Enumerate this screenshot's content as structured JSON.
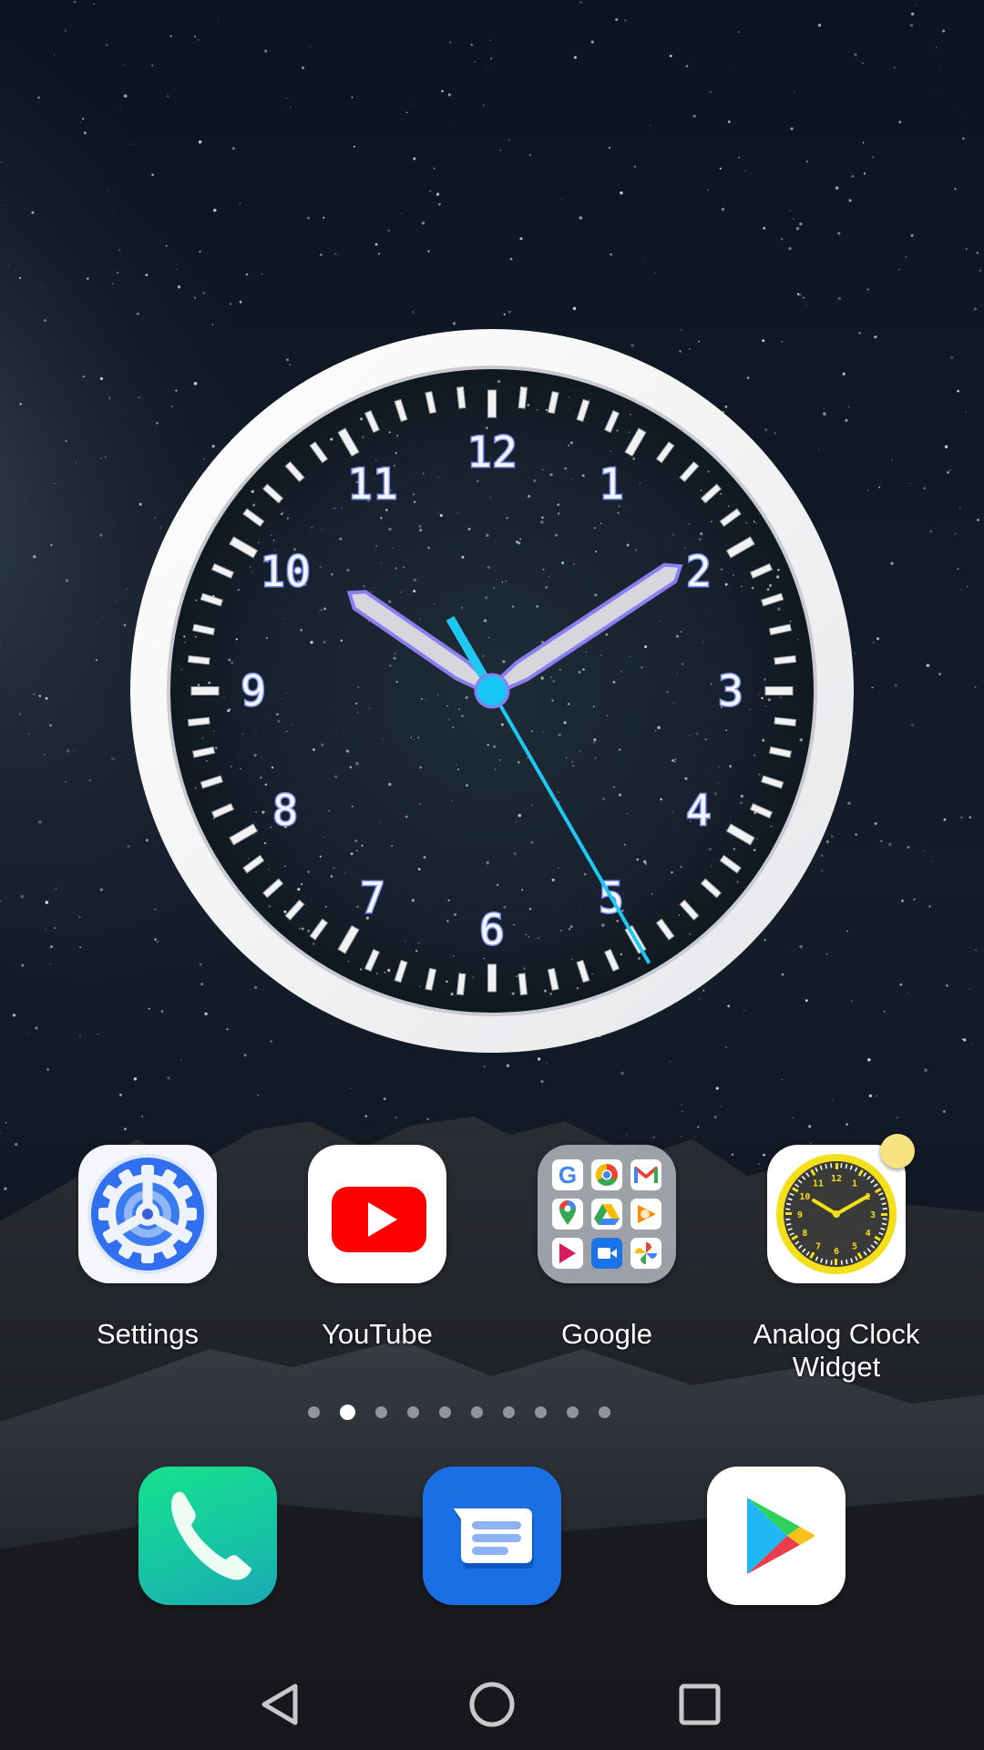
{
  "screen": "Android home screen",
  "clock_widget": {
    "time": {
      "hours": 10,
      "minutes": 9,
      "seconds": 25
    },
    "numerals": [
      "12",
      "1",
      "2",
      "3",
      "4",
      "5",
      "6",
      "7",
      "8",
      "9",
      "10",
      "11"
    ],
    "colors": {
      "bezel": "#f4f5f7",
      "numeral": "#7b8cf0",
      "tick": "#f2f2f2",
      "hand_fill": "#d6d6dc",
      "hand_outline": "#8a7ef0",
      "second_hand": "#1ec8f0",
      "center_cap": "#18c6f4"
    }
  },
  "apps": [
    {
      "name": "settings",
      "label": "Settings",
      "icon": "gear-icon"
    },
    {
      "name": "youtube",
      "label": "YouTube",
      "icon": "youtube-play-icon"
    },
    {
      "name": "google-folder",
      "label": "Google",
      "icon": "folder-icon",
      "folder_items": [
        "Google",
        "Chrome",
        "Gmail",
        "Maps",
        "Drive",
        "Play Music",
        "Play Movies",
        "Duo",
        "Photos"
      ]
    },
    {
      "name": "analog-clock-widget",
      "label_line1": "Analog Clock",
      "label_line2": "Widget",
      "icon": "analog-clock-icon",
      "has_notification_dot": true
    }
  ],
  "page_indicator": {
    "total": 10,
    "active_index": 1
  },
  "dock": [
    {
      "name": "phone",
      "icon": "phone-icon"
    },
    {
      "name": "messages",
      "icon": "message-icon"
    },
    {
      "name": "play-store",
      "icon": "play-store-icon"
    }
  ],
  "nav_bar": [
    {
      "name": "back",
      "icon": "back-triangle-icon"
    },
    {
      "name": "home",
      "icon": "home-circle-icon"
    },
    {
      "name": "recents",
      "icon": "recents-square-icon"
    }
  ]
}
